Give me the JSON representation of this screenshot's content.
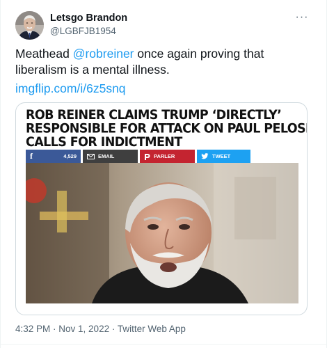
{
  "tweet": {
    "author": {
      "name": "Letsgo Brandon",
      "handle": "@LGBFJB1954"
    },
    "more_icon": "more-horizontal-icon",
    "more_glyph": "···",
    "text_before": "Meathead ",
    "mention": "@robreiner",
    "text_after": " once again proving that liberalism is a mental illness.",
    "link": "imgflip.com/i/6z5snq",
    "media": {
      "headline_lines": [
        "ROB REINER CLAIMS TRUMP ‘DIRECTLY’",
        "RESPONSIBLE FOR ATTACK ON PAUL PELOSI,",
        "CALLS FOR INDICTMENT"
      ],
      "share": {
        "facebook_glyph": "f",
        "facebook_count": "4,529",
        "email_label": "EMAIL",
        "parler_label": "PARLER",
        "tweet_label": "TWEET"
      }
    },
    "timestamp": {
      "time": "4:32 PM",
      "separator": " · ",
      "date": "Nov 1, 2022",
      "source": "Twitter Web App"
    }
  },
  "colors": {
    "accent": "#1d9bf0",
    "facebook": "#3b5998",
    "email": "#3f3f3f",
    "parler": "#c42430",
    "twitter_share": "#1da1f2"
  }
}
